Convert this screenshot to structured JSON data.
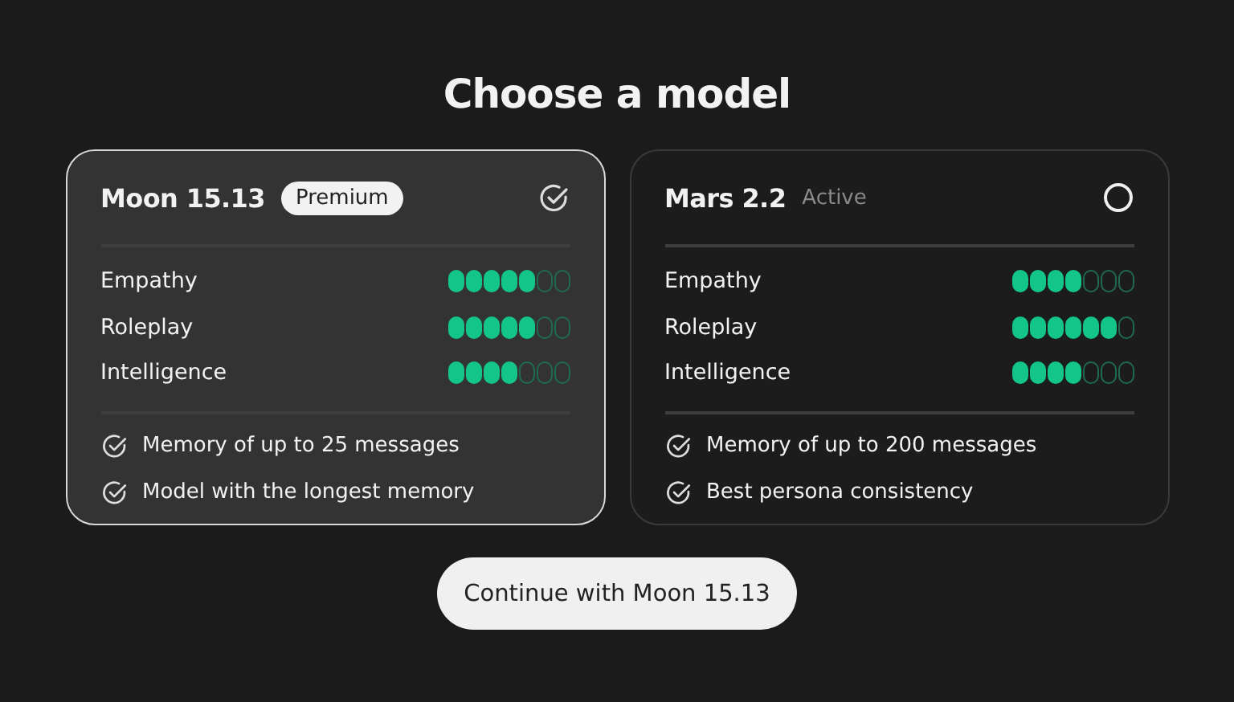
{
  "title": "Choose a model",
  "models": [
    {
      "name": "Moon 15.13",
      "badge": {
        "text": "Premium",
        "kind": "pill"
      },
      "selected": true,
      "ratings": [
        {
          "label": "Empathy",
          "stars": 5
        },
        {
          "label": "Roleplay",
          "stars": 5
        },
        {
          "label": "Intelligence",
          "stars": 4
        }
      ],
      "features": [
        "Memory of up to 25 messages",
        "Model with the longest memory"
      ]
    },
    {
      "name": "Mars 2.2",
      "badge": {
        "text": "Active",
        "kind": "plain"
      },
      "selected": false,
      "ratings": [
        {
          "label": "Empathy",
          "stars": 4
        },
        {
          "label": "Roleplay",
          "stars": 6
        },
        {
          "label": "Intelligence",
          "stars": 4
        }
      ],
      "features": [
        "Memory of up to 200 messages",
        "Best persona consistency"
      ]
    }
  ],
  "button": "Continue with Moon 15.13"
}
